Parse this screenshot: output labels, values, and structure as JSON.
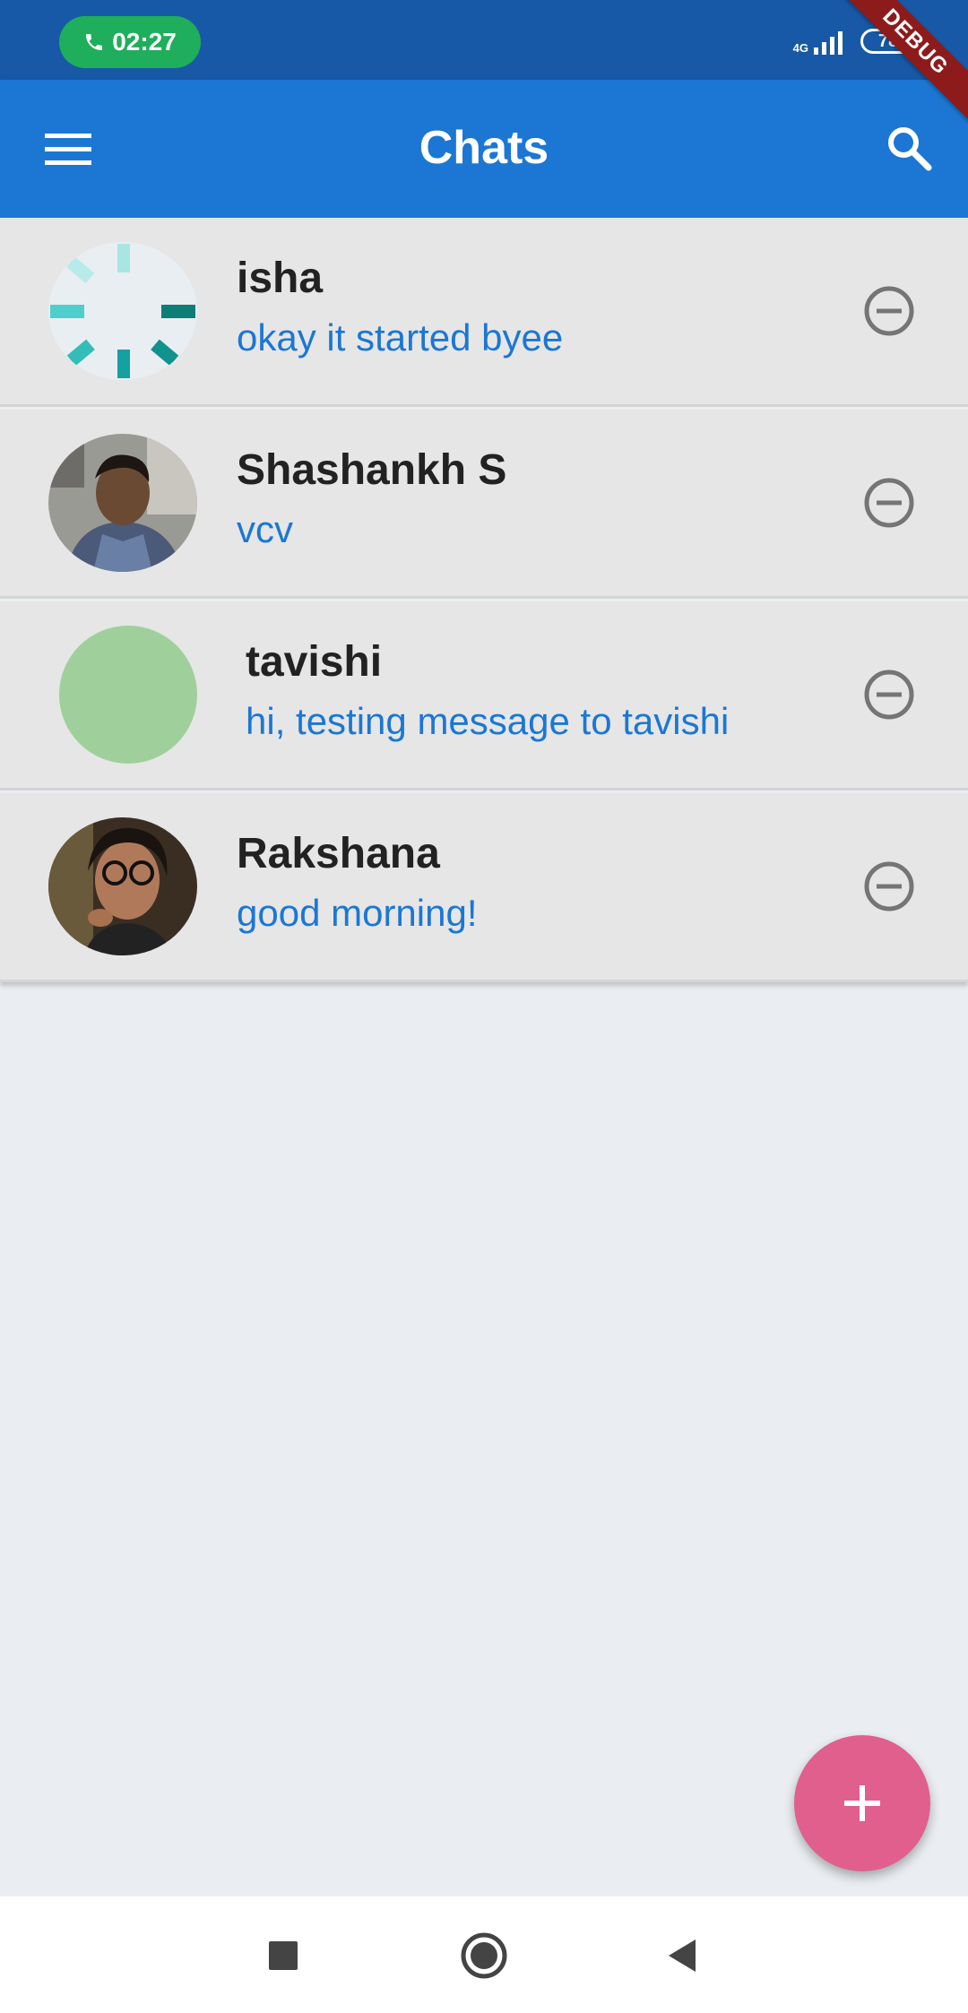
{
  "status_bar": {
    "call_time": "02:27",
    "network_type": "4G",
    "battery": "78",
    "debug_banner": "DEBUG"
  },
  "app_bar": {
    "title": "Chats",
    "menu_icon": "menu-icon",
    "search_icon": "search-icon"
  },
  "chats": [
    {
      "name": "isha",
      "last_message": "okay it started byee",
      "avatar": "loading-spinner"
    },
    {
      "name": "Shashankh S",
      "last_message": "vcv",
      "avatar": "photo"
    },
    {
      "name": "tavishi",
      "last_message": "hi, testing message to tavishi",
      "avatar": "placeholder"
    },
    {
      "name": "Rakshana",
      "last_message": "good morning!",
      "avatar": "photo"
    }
  ],
  "fab": {
    "icon": "plus-icon"
  },
  "nav_bar": {
    "icons": [
      "recents-icon",
      "home-icon",
      "back-icon"
    ]
  },
  "colors": {
    "status_bar": "#1759a6",
    "app_bar": "#1b77d3",
    "message_text": "#1b77d3",
    "fab": "#e05f8c",
    "list_bg": "#e6e6e6",
    "page_bg": "#eaeef2"
  }
}
